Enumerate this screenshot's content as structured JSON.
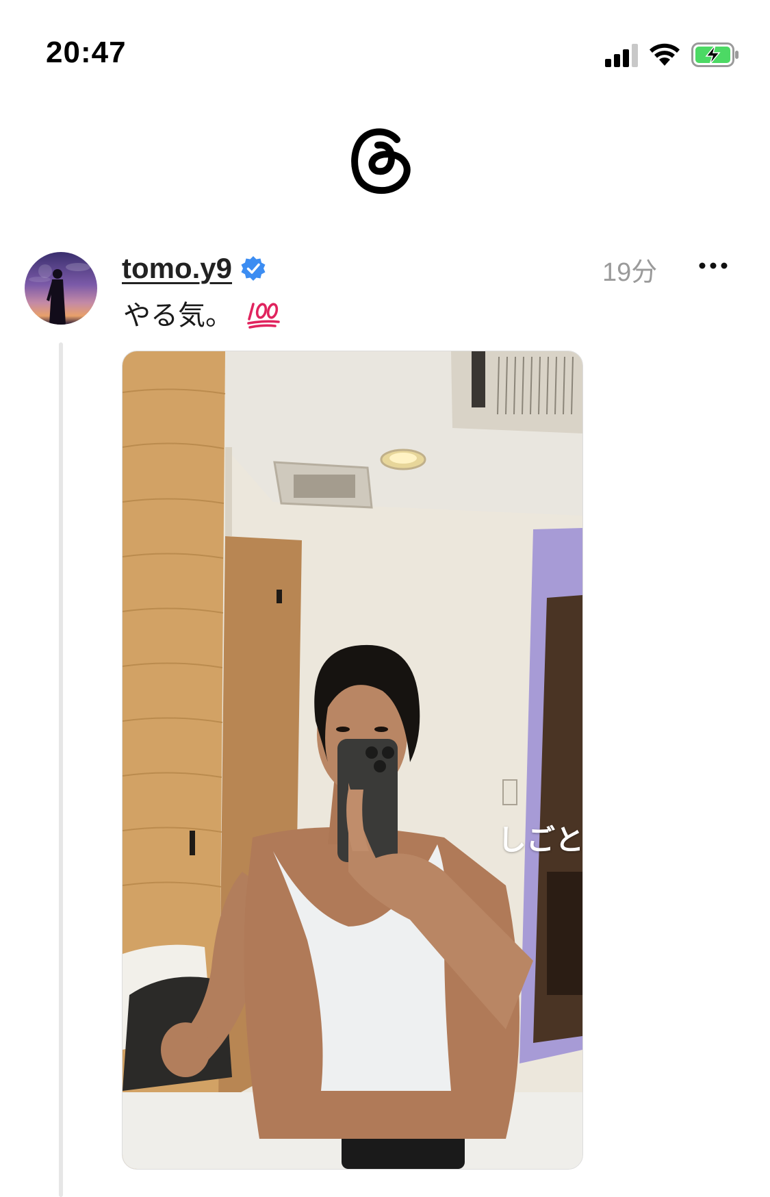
{
  "status_bar": {
    "time": "20:47",
    "icons": [
      "cellular-signal-icon",
      "wifi-icon",
      "battery-charging-icon"
    ]
  },
  "header": {
    "logo": "threads-logo-icon"
  },
  "post": {
    "username": "tomo.y9",
    "verified": true,
    "timestamp": "19分",
    "text": "やる気。",
    "emoji": "hundred-points-icon",
    "image": {
      "caption": "しごと",
      "description_icon": "mirror-selfie-photo"
    },
    "menu_icon": "more-options-icon"
  },
  "colors": {
    "verified_blue": "#3c8df2",
    "timestamp_gray": "#9a9a9a",
    "thread_line": "#e6e6e6",
    "battery_green": "#4cd964",
    "emoji_red": "#e0245e"
  }
}
